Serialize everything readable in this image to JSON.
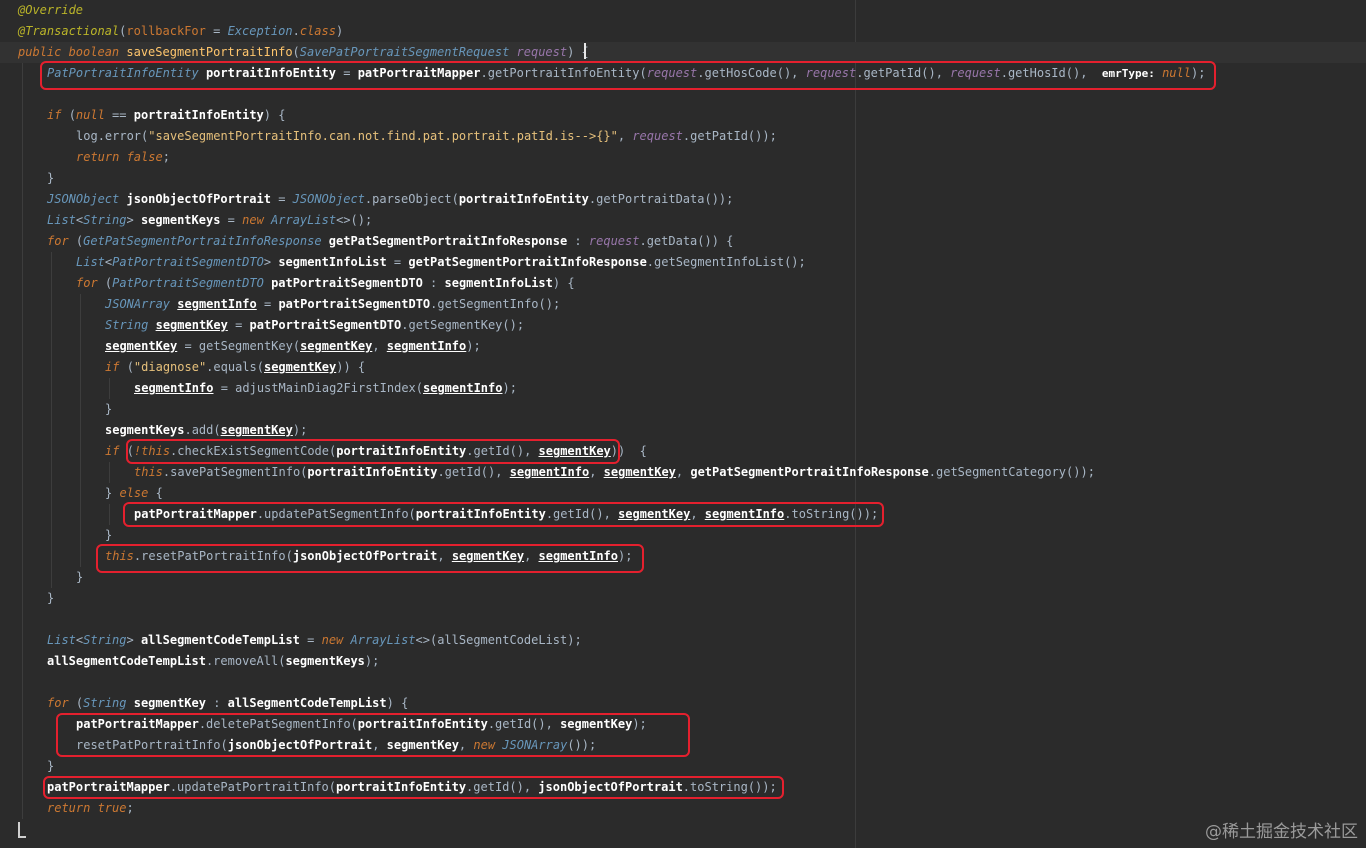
{
  "editor": {
    "watermark": "@稀土掘金技术社区",
    "lines": [
      {
        "indent": 0,
        "tokens": [
          {
            "t": "@Override",
            "c": "anno"
          }
        ]
      },
      {
        "indent": 0,
        "tokens": [
          {
            "t": "@Transactional",
            "c": "anno"
          },
          {
            "t": "(",
            "c": "punct"
          },
          {
            "t": "rollbackFor",
            "c": "kw"
          },
          {
            "t": " = ",
            "c": "plain"
          },
          {
            "t": "Exception",
            "c": "cls"
          },
          {
            "t": ".",
            "c": "punct"
          },
          {
            "t": "class",
            "c": "kwi"
          },
          {
            "t": ")",
            "c": "punct"
          }
        ]
      },
      {
        "indent": 0,
        "current": true,
        "tokens": [
          {
            "t": "public boolean ",
            "c": "kwi"
          },
          {
            "t": "saveSegmentPortraitInfo",
            "c": "method"
          },
          {
            "t": "(",
            "c": "punct"
          },
          {
            "t": "SavePatPortraitSegmentRequest",
            "c": "cls"
          },
          {
            "t": " request",
            "c": "field"
          },
          {
            "t": ") {",
            "c": "punct"
          }
        ]
      },
      {
        "indent": 1,
        "tokens": [
          {
            "t": "PatPortraitInfoEntity",
            "c": "cls"
          },
          {
            "t": " portraitInfoEntity",
            "c": "var"
          },
          {
            "t": " = ",
            "c": "plain"
          },
          {
            "t": "patPortraitMapper",
            "c": "var"
          },
          {
            "t": ".getPortraitInfoEntity(",
            "c": "mcall"
          },
          {
            "t": "request",
            "c": "field"
          },
          {
            "t": ".getHosCode(), ",
            "c": "mcall"
          },
          {
            "t": "request",
            "c": "field"
          },
          {
            "t": ".getPatId(), ",
            "c": "mcall"
          },
          {
            "t": "request",
            "c": "field"
          },
          {
            "t": ".getHosId(),  ",
            "c": "mcall"
          },
          {
            "t": "emrType:",
            "c": "hint"
          },
          {
            "t": " null",
            "c": "kwi"
          },
          {
            "t": ");",
            "c": "punct"
          }
        ]
      },
      {
        "indent": 0,
        "tokens": []
      },
      {
        "indent": 1,
        "tokens": [
          {
            "t": "if ",
            "c": "kwi"
          },
          {
            "t": "(",
            "c": "punct"
          },
          {
            "t": "null",
            "c": "kwi"
          },
          {
            "t": " == ",
            "c": "plain"
          },
          {
            "t": "portraitInfoEntity",
            "c": "var"
          },
          {
            "t": ") {",
            "c": "punct"
          }
        ]
      },
      {
        "indent": 2,
        "tokens": [
          {
            "t": "log",
            "c": "plain"
          },
          {
            "t": ".error(",
            "c": "mcall"
          },
          {
            "t": "\"saveSegmentPortraitInfo.can.not.find.pat.portrait.patId.is-->{}\"",
            "c": "str"
          },
          {
            "t": ", ",
            "c": "punct"
          },
          {
            "t": "request",
            "c": "field"
          },
          {
            "t": ".getPatId());",
            "c": "mcall"
          }
        ]
      },
      {
        "indent": 2,
        "tokens": [
          {
            "t": "return false",
            "c": "kwi"
          },
          {
            "t": ";",
            "c": "punct"
          }
        ]
      },
      {
        "indent": 1,
        "tokens": [
          {
            "t": "}",
            "c": "punct"
          }
        ]
      },
      {
        "indent": 1,
        "tokens": [
          {
            "t": "JSONObject",
            "c": "cls"
          },
          {
            "t": " jsonObjectOfPortrait",
            "c": "var"
          },
          {
            "t": " = ",
            "c": "plain"
          },
          {
            "t": "JSONObject",
            "c": "cls"
          },
          {
            "t": ".parseObject(",
            "c": "mcall"
          },
          {
            "t": "portraitInfoEntity",
            "c": "var"
          },
          {
            "t": ".getPortraitData());",
            "c": "mcall"
          }
        ]
      },
      {
        "indent": 1,
        "tokens": [
          {
            "t": "List",
            "c": "cls"
          },
          {
            "t": "<",
            "c": "punct"
          },
          {
            "t": "String",
            "c": "cls"
          },
          {
            "t": "> ",
            "c": "punct"
          },
          {
            "t": "segmentKeys",
            "c": "var"
          },
          {
            "t": " = ",
            "c": "plain"
          },
          {
            "t": "new ",
            "c": "kwi"
          },
          {
            "t": "ArrayList",
            "c": "cls"
          },
          {
            "t": "<>();",
            "c": "punct"
          }
        ]
      },
      {
        "indent": 1,
        "tokens": [
          {
            "t": "for ",
            "c": "kwi"
          },
          {
            "t": "(",
            "c": "punct"
          },
          {
            "t": "GetPatSegmentPortraitInfoResponse",
            "c": "cls"
          },
          {
            "t": " getPatSegmentPortraitInfoResponse",
            "c": "var"
          },
          {
            "t": " : ",
            "c": "plain"
          },
          {
            "t": "request",
            "c": "field"
          },
          {
            "t": ".getData()) {",
            "c": "mcall"
          }
        ]
      },
      {
        "indent": 2,
        "tokens": [
          {
            "t": "List",
            "c": "cls"
          },
          {
            "t": "<",
            "c": "punct"
          },
          {
            "t": "PatPortraitSegmentDTO",
            "c": "cls"
          },
          {
            "t": "> ",
            "c": "punct"
          },
          {
            "t": "segmentInfoList",
            "c": "var"
          },
          {
            "t": " = ",
            "c": "plain"
          },
          {
            "t": "getPatSegmentPortraitInfoResponse",
            "c": "var"
          },
          {
            "t": ".getSegmentInfoList();",
            "c": "mcall"
          }
        ]
      },
      {
        "indent": 2,
        "tokens": [
          {
            "t": "for ",
            "c": "kwi"
          },
          {
            "t": "(",
            "c": "punct"
          },
          {
            "t": "PatPortraitSegmentDTO",
            "c": "cls"
          },
          {
            "t": " patPortraitSegmentDTO",
            "c": "var"
          },
          {
            "t": " : ",
            "c": "plain"
          },
          {
            "t": "segmentInfoList",
            "c": "var"
          },
          {
            "t": ") {",
            "c": "punct"
          }
        ]
      },
      {
        "indent": 3,
        "tokens": [
          {
            "t": "JSONArray",
            "c": "cls"
          },
          {
            "t": " ",
            "c": "plain"
          },
          {
            "t": "segmentInfo",
            "c": "uvar"
          },
          {
            "t": " = ",
            "c": "plain"
          },
          {
            "t": "patPortraitSegmentDTO",
            "c": "var"
          },
          {
            "t": ".getSegmentInfo();",
            "c": "mcall"
          }
        ]
      },
      {
        "indent": 3,
        "tokens": [
          {
            "t": "String",
            "c": "cls"
          },
          {
            "t": " ",
            "c": "plain"
          },
          {
            "t": "segmentKey",
            "c": "uvar"
          },
          {
            "t": " = ",
            "c": "plain"
          },
          {
            "t": "patPortraitSegmentDTO",
            "c": "var"
          },
          {
            "t": ".getSegmentKey();",
            "c": "mcall"
          }
        ]
      },
      {
        "indent": 3,
        "tokens": [
          {
            "t": "segmentKey",
            "c": "uvar"
          },
          {
            "t": " = getSegmentKey(",
            "c": "mcall"
          },
          {
            "t": "segmentKey",
            "c": "uvar"
          },
          {
            "t": ", ",
            "c": "punct"
          },
          {
            "t": "segmentInfo",
            "c": "uvar"
          },
          {
            "t": ");",
            "c": "punct"
          }
        ]
      },
      {
        "indent": 3,
        "tokens": [
          {
            "t": "if ",
            "c": "kwi"
          },
          {
            "t": "(",
            "c": "punct"
          },
          {
            "t": "\"diagnose\"",
            "c": "str"
          },
          {
            "t": ".equals(",
            "c": "mcall"
          },
          {
            "t": "segmentKey",
            "c": "uvar"
          },
          {
            "t": ")) {",
            "c": "punct"
          }
        ]
      },
      {
        "indent": 4,
        "tokens": [
          {
            "t": "segmentInfo",
            "c": "uvar"
          },
          {
            "t": " = adjustMainDiag2FirstIndex(",
            "c": "mcall"
          },
          {
            "t": "segmentInfo",
            "c": "uvar"
          },
          {
            "t": ");",
            "c": "punct"
          }
        ]
      },
      {
        "indent": 3,
        "tokens": [
          {
            "t": "}",
            "c": "punct"
          }
        ]
      },
      {
        "indent": 3,
        "tokens": [
          {
            "t": "segmentKeys",
            "c": "var"
          },
          {
            "t": ".add(",
            "c": "mcall"
          },
          {
            "t": "segmentKey",
            "c": "uvar"
          },
          {
            "t": ");",
            "c": "punct"
          }
        ]
      },
      {
        "indent": 3,
        "tokens": [
          {
            "t": "if ",
            "c": "kwi"
          },
          {
            "t": "(",
            "c": "punct"
          },
          {
            "t": "!this",
            "c": "kwi"
          },
          {
            "t": ".checkExistSegmentCode(",
            "c": "mcall"
          },
          {
            "t": "portraitInfoEntity",
            "c": "var"
          },
          {
            "t": ".getId(), ",
            "c": "mcall"
          },
          {
            "t": "segmentKey",
            "c": "uvar"
          },
          {
            "t": "))  {",
            "c": "punct"
          }
        ]
      },
      {
        "indent": 4,
        "tokens": [
          {
            "t": "this",
            "c": "kwi"
          },
          {
            "t": ".savePatSegmentInfo(",
            "c": "mcall"
          },
          {
            "t": "portraitInfoEntity",
            "c": "var"
          },
          {
            "t": ".getId(), ",
            "c": "mcall"
          },
          {
            "t": "segmentInfo",
            "c": "uvar"
          },
          {
            "t": ", ",
            "c": "punct"
          },
          {
            "t": "segmentKey",
            "c": "uvar"
          },
          {
            "t": ", ",
            "c": "punct"
          },
          {
            "t": "getPatSegmentPortraitInfoResponse",
            "c": "var"
          },
          {
            "t": ".getSegmentCategory());",
            "c": "mcall"
          }
        ]
      },
      {
        "indent": 3,
        "tokens": [
          {
            "t": "} ",
            "c": "punct"
          },
          {
            "t": "else",
            "c": "kwi"
          },
          {
            "t": " {",
            "c": "punct"
          }
        ]
      },
      {
        "indent": 4,
        "tokens": [
          {
            "t": "patPortraitMapper",
            "c": "var"
          },
          {
            "t": ".updatePatSegmentInfo(",
            "c": "mcall"
          },
          {
            "t": "portraitInfoEntity",
            "c": "var"
          },
          {
            "t": ".getId(), ",
            "c": "mcall"
          },
          {
            "t": "segmentKey",
            "c": "uvar"
          },
          {
            "t": ", ",
            "c": "punct"
          },
          {
            "t": "segmentInfo",
            "c": "uvar"
          },
          {
            "t": ".toString());",
            "c": "mcall"
          }
        ]
      },
      {
        "indent": 3,
        "tokens": [
          {
            "t": "}",
            "c": "punct"
          }
        ]
      },
      {
        "indent": 3,
        "tokens": [
          {
            "t": "this",
            "c": "kwi"
          },
          {
            "t": ".resetPatPortraitInfo(",
            "c": "mcall"
          },
          {
            "t": "jsonObjectOfPortrait",
            "c": "var"
          },
          {
            "t": ", ",
            "c": "punct"
          },
          {
            "t": "segmentKey",
            "c": "uvar"
          },
          {
            "t": ", ",
            "c": "punct"
          },
          {
            "t": "segmentInfo",
            "c": "uvar"
          },
          {
            "t": ");",
            "c": "punct"
          }
        ]
      },
      {
        "indent": 2,
        "tokens": [
          {
            "t": "}",
            "c": "punct"
          }
        ]
      },
      {
        "indent": 1,
        "tokens": [
          {
            "t": "}",
            "c": "punct"
          }
        ]
      },
      {
        "indent": 0,
        "tokens": []
      },
      {
        "indent": 1,
        "tokens": [
          {
            "t": "List",
            "c": "cls"
          },
          {
            "t": "<",
            "c": "punct"
          },
          {
            "t": "String",
            "c": "cls"
          },
          {
            "t": "> ",
            "c": "punct"
          },
          {
            "t": "allSegmentCodeTempList",
            "c": "var"
          },
          {
            "t": " = ",
            "c": "plain"
          },
          {
            "t": "new ",
            "c": "kwi"
          },
          {
            "t": "ArrayList",
            "c": "cls"
          },
          {
            "t": "<>(allSegmentCodeList);",
            "c": "punct"
          }
        ]
      },
      {
        "indent": 1,
        "tokens": [
          {
            "t": "allSegmentCodeTempList",
            "c": "var"
          },
          {
            "t": ".removeAll(",
            "c": "mcall"
          },
          {
            "t": "segmentKeys",
            "c": "var"
          },
          {
            "t": ");",
            "c": "punct"
          }
        ]
      },
      {
        "indent": 0,
        "tokens": []
      },
      {
        "indent": 1,
        "tokens": [
          {
            "t": "for ",
            "c": "kwi"
          },
          {
            "t": "(",
            "c": "punct"
          },
          {
            "t": "String",
            "c": "cls"
          },
          {
            "t": " segmentKey",
            "c": "var"
          },
          {
            "t": " : ",
            "c": "plain"
          },
          {
            "t": "allSegmentCodeTempList",
            "c": "var"
          },
          {
            "t": ") {",
            "c": "punct"
          }
        ]
      },
      {
        "indent": 2,
        "tokens": [
          {
            "t": "patPortraitMapper",
            "c": "var"
          },
          {
            "t": ".deletePatSegmentInfo(",
            "c": "mcall"
          },
          {
            "t": "portraitInfoEntity",
            "c": "var"
          },
          {
            "t": ".getId(), ",
            "c": "mcall"
          },
          {
            "t": "segmentKey",
            "c": "var"
          },
          {
            "t": ");",
            "c": "punct"
          }
        ]
      },
      {
        "indent": 2,
        "tokens": [
          {
            "t": "resetPatPortraitInfo(",
            "c": "mcall"
          },
          {
            "t": "jsonObjectOfPortrait",
            "c": "var"
          },
          {
            "t": ", ",
            "c": "punct"
          },
          {
            "t": "segmentKey",
            "c": "var"
          },
          {
            "t": ", ",
            "c": "punct"
          },
          {
            "t": "new ",
            "c": "kwi"
          },
          {
            "t": "JSONArray",
            "c": "cls"
          },
          {
            "t": "());",
            "c": "punct"
          }
        ]
      },
      {
        "indent": 1,
        "tokens": [
          {
            "t": "}",
            "c": "punct"
          }
        ]
      },
      {
        "indent": 1,
        "tokens": [
          {
            "t": "patPortraitMapper",
            "c": "var"
          },
          {
            "t": ".updatePatPortraitInfo(",
            "c": "mcall"
          },
          {
            "t": "portraitInfoEntity",
            "c": "var"
          },
          {
            "t": ".getId(), ",
            "c": "mcall"
          },
          {
            "t": "jsonObjectOfPortrait",
            "c": "var"
          },
          {
            "t": ".toString());",
            "c": "mcall"
          }
        ]
      },
      {
        "indent": 1,
        "tokens": [
          {
            "t": "return true",
            "c": "kwi"
          },
          {
            "t": ";",
            "c": "punct"
          }
        ]
      }
    ]
  }
}
